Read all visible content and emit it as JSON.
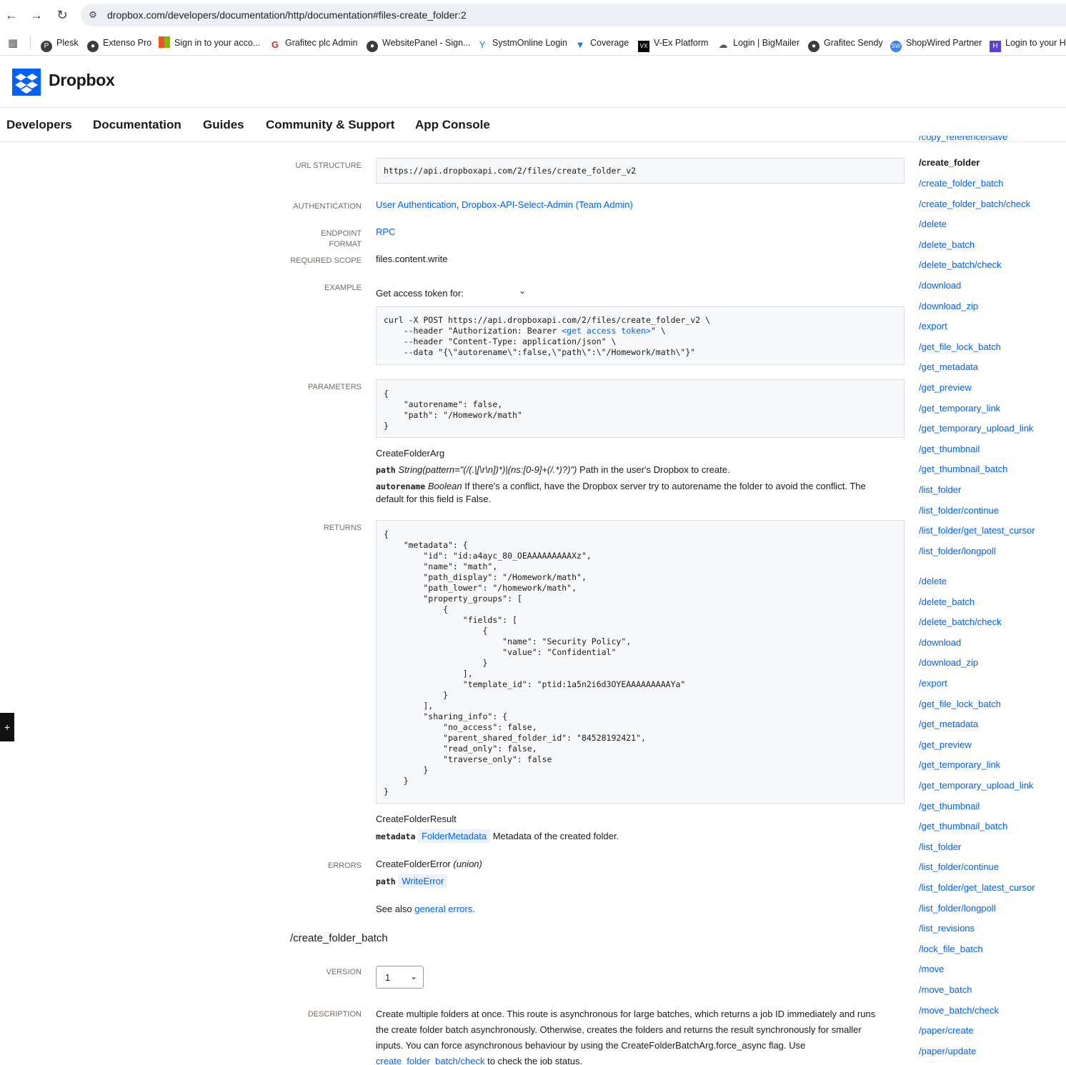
{
  "browser": {
    "url": "dropbox.com/developers/documentation/http/documentation#files-create_folder:2",
    "bookmarks": [
      "Plesk",
      "Extenso Pro",
      "Sign in to your acco...",
      "Grafitec plc Admin",
      "WebsitePanel - Sign...",
      "SystmOnline Login",
      "Coverage",
      "V-Ex Platform",
      "Login | BigMailer",
      "Grafitec Sendy",
      "ShopWired Partner",
      "Login to your Ho"
    ]
  },
  "header": {
    "brand": "Dropbox"
  },
  "nav": [
    "Developers",
    "Documentation",
    "Guides",
    "Community & Support",
    "App Console"
  ],
  "endpoint": {
    "url_structure_label": "URL STRUCTURE",
    "url_structure": "https://api.dropboxapi.com/2/files/create_folder_v2",
    "authentication_label": "AUTHENTICATION",
    "auth_user": "User Authentication",
    "auth_sep": ",",
    "auth_admin": "Dropbox-API-Select-Admin (Team Admin)",
    "endpoint_format_label_1": "ENDPOINT",
    "endpoint_format_label_2": "FORMAT",
    "endpoint_format": "RPC",
    "required_scope_label": "REQUIRED SCOPE",
    "required_scope": "files.content.write",
    "example_label": "EXAMPLE",
    "access_token_label": "Get access token for:",
    "example_code_1": "curl -X POST https://api.dropboxapi.com/2/files/create_folder_v2 \\",
    "example_code_2a": "    --header \"Authorization: Bearer ",
    "example_code_2b": "<get access token>",
    "example_code_2c": "\" \\",
    "example_code_3": "    --header \"Content-Type: application/json\" \\",
    "example_code_4": "    --data \"{\\\"autorename\\\":false,\\\"path\\\":\\\"/Homework/math\\\"}\"",
    "parameters_label": "PARAMETERS",
    "parameters_code": "{\n    \"autorename\": false,\n    \"path\": \"/Homework/math\"\n}",
    "arg_name": "CreateFolderArg",
    "param_path_name": "path",
    "param_path_type": "String(pattern=\"(/(.|[\\r\\n])*)|(ns:[0-9]+(/.*)?)\")",
    "param_path_desc": "Path in the user's Dropbox to create.",
    "param_autorename_name": "autorename",
    "param_autorename_type": "Boolean",
    "param_autorename_desc_1": "If there's a conflict, have the Dropbox server try to autorename the folder to avoid the conflict. The",
    "param_autorename_desc_2": "default for this field is False.",
    "returns_label": "RETURNS",
    "returns_code": "{\n    \"metadata\": {\n        \"id\": \"id:a4ayc_80_OEAAAAAAAAAXz\",\n        \"name\": \"math\",\n        \"path_display\": \"/Homework/math\",\n        \"path_lower\": \"/homework/math\",\n        \"property_groups\": [\n            {\n                \"fields\": [\n                    {\n                        \"name\": \"Security Policy\",\n                        \"value\": \"Confidential\"\n                    }\n                ],\n                \"template_id\": \"ptid:1a5n2i6d3OYEAAAAAAAAAYa\"\n            }\n        ],\n        \"sharing_info\": {\n            \"no_access\": false,\n            \"parent_shared_folder_id\": \"84528192421\",\n            \"read_only\": false,\n            \"traverse_only\": false\n        }\n    }\n}",
    "result_name": "CreateFolderResult",
    "result_field": "metadata",
    "result_type": "FolderMetadata",
    "result_desc": "Metadata of the created folder.",
    "errors_label": "ERRORS",
    "error_name": "CreateFolderError",
    "error_kind": "(union)",
    "error_field": "path",
    "error_type": "WriteError",
    "see_also_prefix": "See also",
    "see_also_link": "general errors",
    "see_also_suffix": "."
  },
  "next_section": {
    "title": "/create_folder_batch",
    "version_label": "VERSION",
    "version_value": "1",
    "description_label": "DESCRIPTION",
    "description_1": "Create multiple folders at once. This route is asynchronous for large batches, which returns a job ID immediately and runs",
    "description_2": "the create folder batch asynchronously. Otherwise, creates the folders and returns the result synchronously for smaller",
    "description_3": "inputs. You can force asynchronous behaviour by using the CreateFolderBatchArg.force_async flag. Use",
    "description_link": "create_folder_batch/check",
    "description_4": "to check the job status."
  },
  "sidebar": {
    "clipped_top": "/copy_reference/save",
    "active": "/create_folder",
    "items_a": [
      "/create_folder_batch",
      "/create_folder_batch/check",
      "/delete",
      "/delete_batch",
      "/delete_batch/check",
      "/download",
      "/download_zip",
      "/export",
      "/get_file_lock_batch",
      "/get_metadata",
      "/get_preview",
      "/get_temporary_link",
      "/get_temporary_upload_link",
      "/get_thumbnail",
      "/get_thumbnail_batch",
      "/list_folder",
      "/list_folder/continue",
      "/list_folder/get_latest_cursor",
      "/list_folder/longpoll"
    ],
    "items_b": [
      "/delete",
      "/delete_batch",
      "/delete_batch/check",
      "/download",
      "/download_zip",
      "/export",
      "/get_file_lock_batch",
      "/get_metadata",
      "/get_preview",
      "/get_temporary_link",
      "/get_temporary_upload_link",
      "/get_thumbnail",
      "/get_thumbnail_batch",
      "/list_folder",
      "/list_folder/continue",
      "/list_folder/get_latest_cursor",
      "/list_folder/longpoll",
      "/list_revisions",
      "/lock_file_batch",
      "/move",
      "/move_batch",
      "/move_batch/check",
      "/paper/create",
      "/paper/update"
    ]
  }
}
